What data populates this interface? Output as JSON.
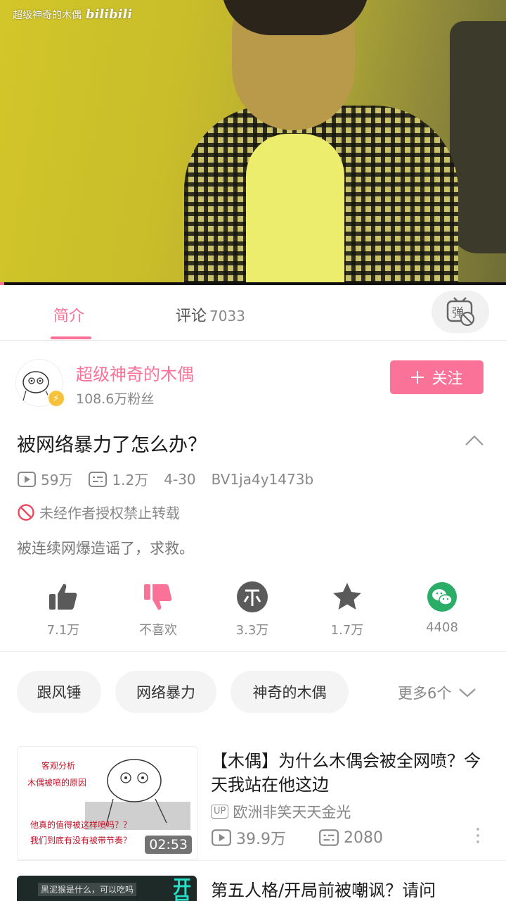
{
  "video": {
    "watermark_channel": "超级神奇的木偶",
    "watermark_logo": "bilibili",
    "progress_fraction": 0.008
  },
  "tabs": [
    {
      "label": "简介",
      "active": true
    },
    {
      "label": "评论",
      "count": "7033",
      "active": false
    }
  ],
  "danmaku_button": {
    "icon": "danmaku-toggle-icon",
    "glyph": "弹"
  },
  "uploader": {
    "name": "超级神奇的木偶",
    "fans": "108.6万粉丝",
    "follow_label": "关注",
    "follow_icon": "plus-icon"
  },
  "video_info": {
    "title": "被网络暴力了怎么办？",
    "views": "59万",
    "danmaku": "1.2万",
    "date": "4-30",
    "bvid": "BV1ja4y1473b",
    "notice": "未经作者授权禁止转载",
    "description": "被连续网爆造谣了，求救。"
  },
  "actions": [
    {
      "name": "like",
      "icon": "thumbs-up-icon",
      "label": "7.1万"
    },
    {
      "name": "dislike",
      "icon": "thumbs-down-icon",
      "label": "不喜欢"
    },
    {
      "name": "coin",
      "icon": "coin-icon",
      "label": "3.3万"
    },
    {
      "name": "favorite",
      "icon": "star-icon",
      "label": "1.7万"
    },
    {
      "name": "share",
      "icon": "wechat-icon",
      "label": "4408"
    }
  ],
  "tags": [
    "跟风锤",
    "网络暴力",
    "神奇的木偶"
  ],
  "tags_more": "更多6个",
  "related": [
    {
      "title": "【木偶】为什么木偶会被全网喷？今天我站在他这边",
      "up": "欧洲非笑天天金光",
      "views": "39.9万",
      "danmaku": "2080",
      "duration": "02:53",
      "thumb_text": [
        "客观分析",
        "木偶被喷的原因",
        "他真的值得被这样喷吗？？",
        "我们到底有没有被带节奏？"
      ]
    },
    {
      "title": "第五人格/开局前被嘲讽？请问",
      "thumb_text": [
        "黑泥猴是什么，可以吃吗",
        "开",
        "局"
      ]
    }
  ],
  "colors": {
    "accent": "#fb7299",
    "wechat": "#2aae67",
    "gray_icon": "#5a5a5a"
  }
}
